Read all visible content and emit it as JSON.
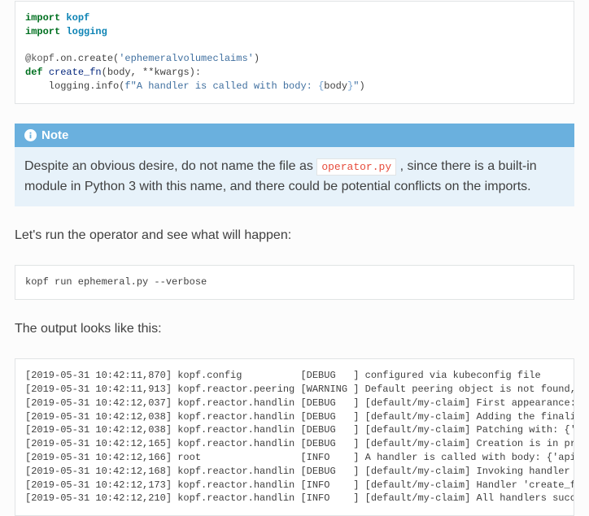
{
  "code1": {
    "l1a": "import",
    "l1b": "kopf",
    "l2a": "import",
    "l2b": "logging",
    "l3a": "@kopf",
    "l3b": ".on.create(",
    "l3c": "'ephemeralvolumeclaims'",
    "l3d": ")",
    "l4a": "def",
    "l4b": "create_fn",
    "l4c": "(body, **kwargs):",
    "l5a": "    logging.info(",
    "l5b": "f\"A handler is called with body: ",
    "l5c": "{",
    "l5d": "body",
    "l5e": "}",
    "l5f": "\"",
    "l5g": ")"
  },
  "note": {
    "title": "Note",
    "text_before": "Despite an obvious desire, do not name the file as ",
    "literal": "operator.py",
    "text_after": " , since there is a built-in module in Python 3 with this name, and there could be potential conflicts on the imports."
  },
  "para1": "Let's run the operator and see what will happen:",
  "code2": "kopf run ephemeral.py --verbose",
  "para2": "The output looks like this:",
  "log": [
    "[2019-05-31 10:42:11,870] kopf.config          [DEBUG   ] configured via kubeconfig file",
    "[2019-05-31 10:42:11,913] kopf.reactor.peering [WARNING ] Default peering object is not found, falling b",
    "[2019-05-31 10:42:12,037] kopf.reactor.handlin [DEBUG   ] [default/my-claim] First appearance: {'apiVers",
    "[2019-05-31 10:42:12,038] kopf.reactor.handlin [DEBUG   ] [default/my-claim] Adding the finalizer, thus ",
    "[2019-05-31 10:42:12,038] kopf.reactor.handlin [DEBUG   ] [default/my-claim] Patching with: {'metadata':",
    "[2019-05-31 10:42:12,165] kopf.reactor.handlin [DEBUG   ] [default/my-claim] Creation is in progress: {'",
    "[2019-05-31 10:42:12,166] root                 [INFO    ] A handler is called with body: {'apiVersion': ",
    "[2019-05-31 10:42:12,168] kopf.reactor.handlin [DEBUG   ] [default/my-claim] Invoking handler 'create_fn",
    "[2019-05-31 10:42:12,173] kopf.reactor.handlin [INFO    ] [default/my-claim] Handler 'create_fn' succeed",
    "[2019-05-31 10:42:12,210] kopf.reactor.handlin [INFO    ] [default/my-claim] All handlers succeeded for "
  ]
}
